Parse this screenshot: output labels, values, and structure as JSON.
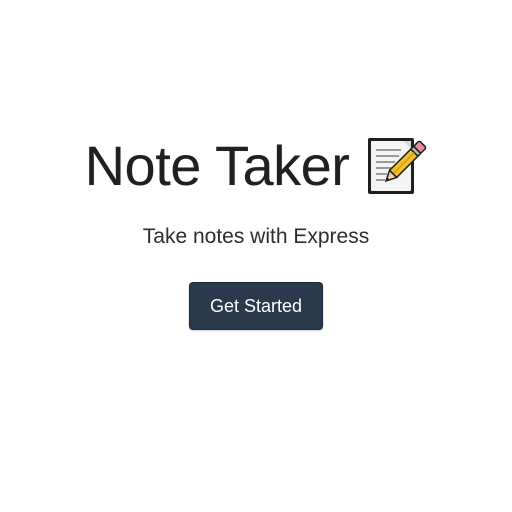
{
  "hero": {
    "title": "Note Taker",
    "title_icon": "memo-pencil-icon",
    "subtitle": "Take notes with Express",
    "cta_label": "Get Started"
  },
  "colors": {
    "background": "#ffffff",
    "title": "#1f2024",
    "button_background": "#2a3a4c",
    "button_text": "#ffffff"
  }
}
